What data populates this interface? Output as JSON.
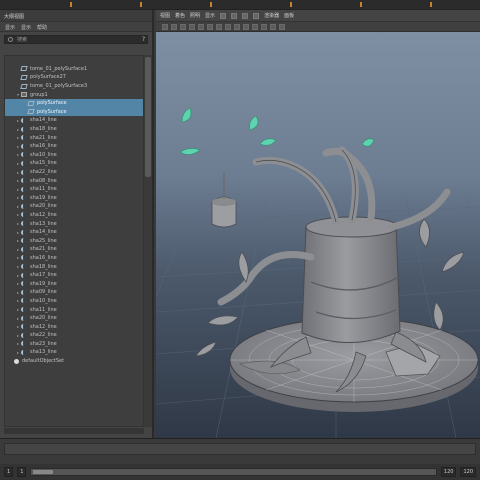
{
  "outliner": {
    "title": "大纲视图",
    "menu": [
      "显示",
      "显示",
      "帮助"
    ],
    "search_placeholder": "搜索",
    "help_label": "?",
    "items": [
      {
        "label": "",
        "icon": "camera",
        "indent": 0,
        "arrow": "",
        "selected": false
      },
      {
        "label": "tome_01_polySurface1",
        "icon": "mesh",
        "indent": 1,
        "arrow": "",
        "selected": false
      },
      {
        "label": "polySurface27",
        "icon": "mesh",
        "indent": 1,
        "arrow": "",
        "selected": false
      },
      {
        "label": "tome_01_polySurface3",
        "icon": "mesh",
        "indent": 1,
        "arrow": "",
        "selected": false
      },
      {
        "label": "group1",
        "icon": "group",
        "indent": 1,
        "arrow": "▾",
        "selected": false
      },
      {
        "label": "polySurface",
        "icon": "mesh",
        "indent": 2,
        "arrow": "",
        "selected": true
      },
      {
        "label": "polySurface",
        "icon": "mesh",
        "indent": 2,
        "arrow": "",
        "selected": true
      },
      {
        "label": "sha14_line",
        "icon": "curve",
        "indent": 1,
        "arrow": "▸",
        "selected": false
      },
      {
        "label": "sha18_line",
        "icon": "curve",
        "indent": 1,
        "arrow": "▸",
        "selected": false
      },
      {
        "label": "sha21_line",
        "icon": "curve",
        "indent": 1,
        "arrow": "▸",
        "selected": false
      },
      {
        "label": "sha16_line",
        "icon": "curve",
        "indent": 1,
        "arrow": "▸",
        "selected": false
      },
      {
        "label": "sha10_line",
        "icon": "curve",
        "indent": 1,
        "arrow": "▸",
        "selected": false
      },
      {
        "label": "sha15_line",
        "icon": "curve",
        "indent": 1,
        "arrow": "▸",
        "selected": false
      },
      {
        "label": "sha22_line",
        "icon": "curve",
        "indent": 1,
        "arrow": "▸",
        "selected": false
      },
      {
        "label": "sha08_line",
        "icon": "curve",
        "indent": 1,
        "arrow": "▸",
        "selected": false
      },
      {
        "label": "sha11_line",
        "icon": "curve",
        "indent": 1,
        "arrow": "▸",
        "selected": false
      },
      {
        "label": "sha19_line",
        "icon": "curve",
        "indent": 1,
        "arrow": "▸",
        "selected": false
      },
      {
        "label": "sha20_line",
        "icon": "curve",
        "indent": 1,
        "arrow": "▸",
        "selected": false
      },
      {
        "label": "sha12_line",
        "icon": "curve",
        "indent": 1,
        "arrow": "▸",
        "selected": false
      },
      {
        "label": "sha13_line",
        "icon": "curve",
        "indent": 1,
        "arrow": "▸",
        "selected": false
      },
      {
        "label": "sha14_line",
        "icon": "curve",
        "indent": 1,
        "arrow": "▸",
        "selected": false
      },
      {
        "label": "sha25_line",
        "icon": "curve",
        "indent": 1,
        "arrow": "▸",
        "selected": false
      },
      {
        "label": "sha21_line",
        "icon": "curve",
        "indent": 1,
        "arrow": "▸",
        "selected": false
      },
      {
        "label": "sha16_line",
        "icon": "curve",
        "indent": 1,
        "arrow": "▸",
        "selected": false
      },
      {
        "label": "sha18_line",
        "icon": "curve",
        "indent": 1,
        "arrow": "▸",
        "selected": false
      },
      {
        "label": "sha17_line",
        "icon": "curve",
        "indent": 1,
        "arrow": "▸",
        "selected": false
      },
      {
        "label": "sha19_line",
        "icon": "curve",
        "indent": 1,
        "arrow": "▸",
        "selected": false
      },
      {
        "label": "sha09_line",
        "icon": "curve",
        "indent": 1,
        "arrow": "▸",
        "selected": false
      },
      {
        "label": "sha10_line",
        "icon": "curve",
        "indent": 1,
        "arrow": "▸",
        "selected": false
      },
      {
        "label": "sha11_line",
        "icon": "curve",
        "indent": 1,
        "arrow": "▸",
        "selected": false
      },
      {
        "label": "sha20_line",
        "icon": "curve",
        "indent": 1,
        "arrow": "▸",
        "selected": false
      },
      {
        "label": "sha12_line",
        "icon": "curve",
        "indent": 1,
        "arrow": "▸",
        "selected": false
      },
      {
        "label": "sha22_line",
        "icon": "curve",
        "indent": 1,
        "arrow": "▸",
        "selected": false
      },
      {
        "label": "sha23_line",
        "icon": "curve",
        "indent": 1,
        "arrow": "▸",
        "selected": false
      },
      {
        "label": "sha13_line",
        "icon": "curve",
        "indent": 1,
        "arrow": "▸",
        "selected": false
      },
      {
        "label": "defaultObjectSet",
        "icon": "light",
        "indent": 0,
        "arrow": "",
        "selected": false
      }
    ]
  },
  "viewport": {
    "menus": [
      "视图",
      "着色",
      "照明",
      "显示",
      "渲染器",
      "面板"
    ],
    "model_colors": {
      "clay": "#8d8f93",
      "leaf": "#5ed3b0",
      "grid": "#5a6a7d"
    }
  },
  "range": {
    "start": "1",
    "current": "1",
    "end": "120",
    "end2": "120"
  },
  "colors": {
    "accent_tick": "#c6822f",
    "selection": "#5285a6"
  }
}
